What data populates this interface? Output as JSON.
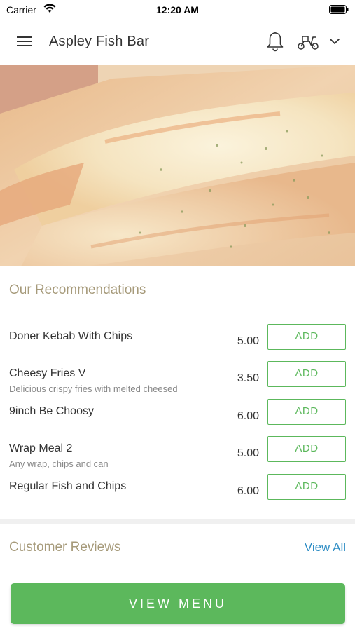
{
  "status_bar": {
    "carrier": "Carrier",
    "time": "12:20 AM"
  },
  "header": {
    "title": "Aspley Fish Bar",
    "icons": [
      "hamburger-menu-icon",
      "bell-icon",
      "scooter-delivery-icon",
      "chevron-down-icon"
    ]
  },
  "recommendations": {
    "title": "Our Recommendations",
    "add_label": "ADD",
    "items": [
      {
        "name": "Doner Kebab With Chips",
        "description": "",
        "price": "5.00"
      },
      {
        "name": "Cheesy Fries V",
        "description": "Delicious crispy fries with melted cheesed",
        "price": "3.50"
      },
      {
        "name": "9inch Be Choosy",
        "description": "",
        "price": "6.00"
      },
      {
        "name": "Wrap Meal 2",
        "description": "Any wrap, chips and can",
        "price": "5.00"
      },
      {
        "name": "Regular Fish and Chips",
        "description": "",
        "price": "6.00"
      }
    ]
  },
  "reviews": {
    "title": "Customer Reviews",
    "view_all": "View All"
  },
  "footer": {
    "view_menu": "VIEW MENU"
  },
  "colors": {
    "accent_green": "#5cb85c",
    "section_title": "#a69a7a",
    "link_blue": "#2c8cc4"
  }
}
